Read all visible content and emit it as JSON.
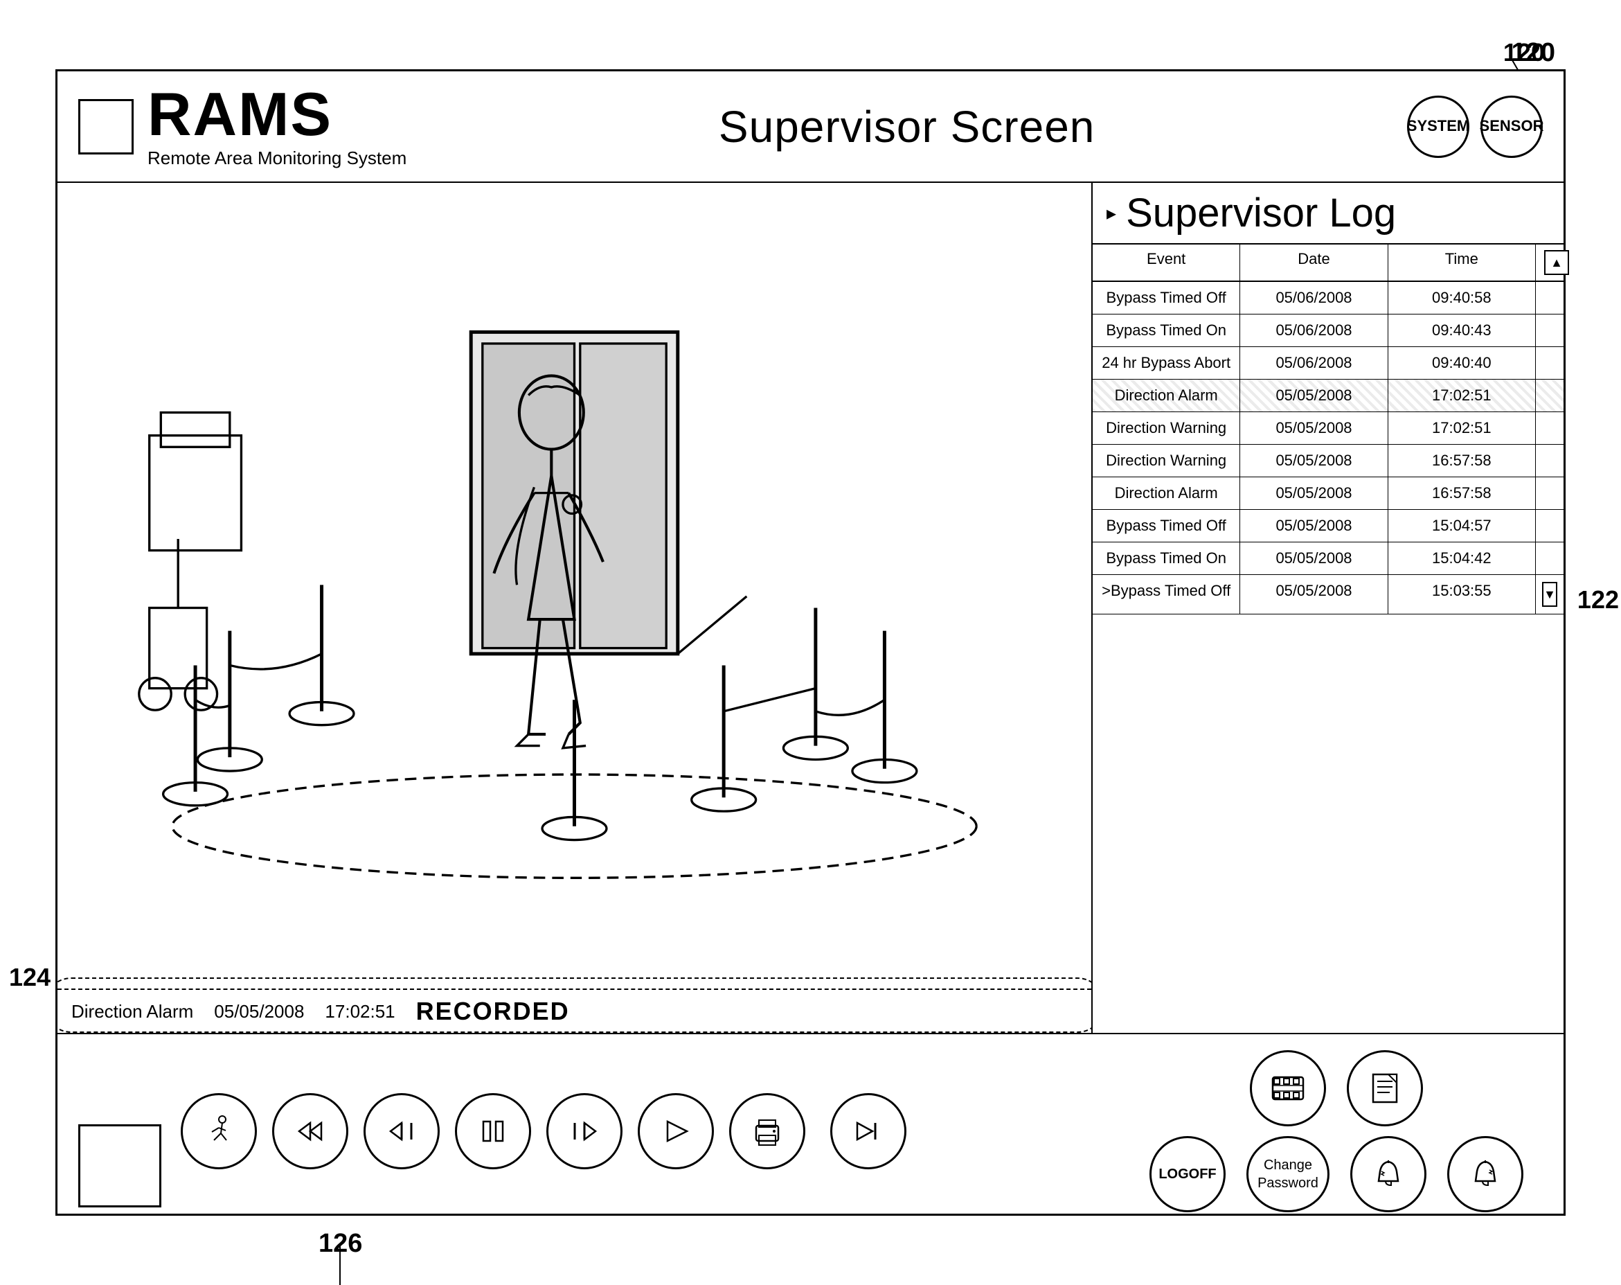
{
  "ref": {
    "label_120": "120",
    "label_122": "122",
    "label_124": "124",
    "label_126": "126"
  },
  "header": {
    "title": "RAMS",
    "subtitle": "Remote Area Monitoring System",
    "screen_title": "Supervisor Screen",
    "system_btn": "SYSTEM",
    "sensor_btn": "SENSOR"
  },
  "log": {
    "title": "Supervisor Log",
    "columns": [
      "Event",
      "Date",
      "Time"
    ],
    "rows": [
      {
        "event": "Bypass Timed Off",
        "date": "05/06/2008",
        "time": "09:40:58",
        "highlighted": false
      },
      {
        "event": "Bypass Timed On",
        "date": "05/06/2008",
        "time": "09:40:43",
        "highlighted": false
      },
      {
        "event": "24 hr Bypass Abort",
        "date": "05/06/2008",
        "time": "09:40:40",
        "highlighted": false
      },
      {
        "event": "Direction Alarm",
        "date": "05/05/2008",
        "time": "17:02:51",
        "highlighted": true
      },
      {
        "event": "Direction Warning",
        "date": "05/05/2008",
        "time": "17:02:51",
        "highlighted": false
      },
      {
        "event": "Direction Warning",
        "date": "05/05/2008",
        "time": "16:57:58",
        "highlighted": false
      },
      {
        "event": "Direction Alarm",
        "date": "05/05/2008",
        "time": "16:57:58",
        "highlighted": false
      },
      {
        "event": "Bypass Timed Off",
        "date": "05/05/2008",
        "time": "15:04:57",
        "highlighted": false
      },
      {
        "event": "Bypass Timed On",
        "date": "05/05/2008",
        "time": "15:04:42",
        "highlighted": false
      },
      {
        "event": ">Bypass Timed Off",
        "date": "05/05/2008",
        "time": "15:03:55",
        "highlighted": false
      }
    ]
  },
  "status_bar": {
    "event": "Direction Alarm",
    "date": "05/05/2008",
    "time": "17:02:51",
    "recorded": "RECORDED"
  },
  "controls": {
    "walk_icon": "🚶",
    "rewind_icon": "◀",
    "step_back_icon": "◀|",
    "pause_icon": "⏸",
    "step_fwd_icon": "|▶",
    "play_icon": "▶",
    "print_icon": "🖨",
    "skip_icon": "▷|",
    "logoff_label": "LOGOFF",
    "change_password_label": "Change\nPassword",
    "film_icon": "🎬",
    "doc_icon": "📄",
    "bell_icon": "🔔",
    "bell2_icon": "🔔"
  }
}
